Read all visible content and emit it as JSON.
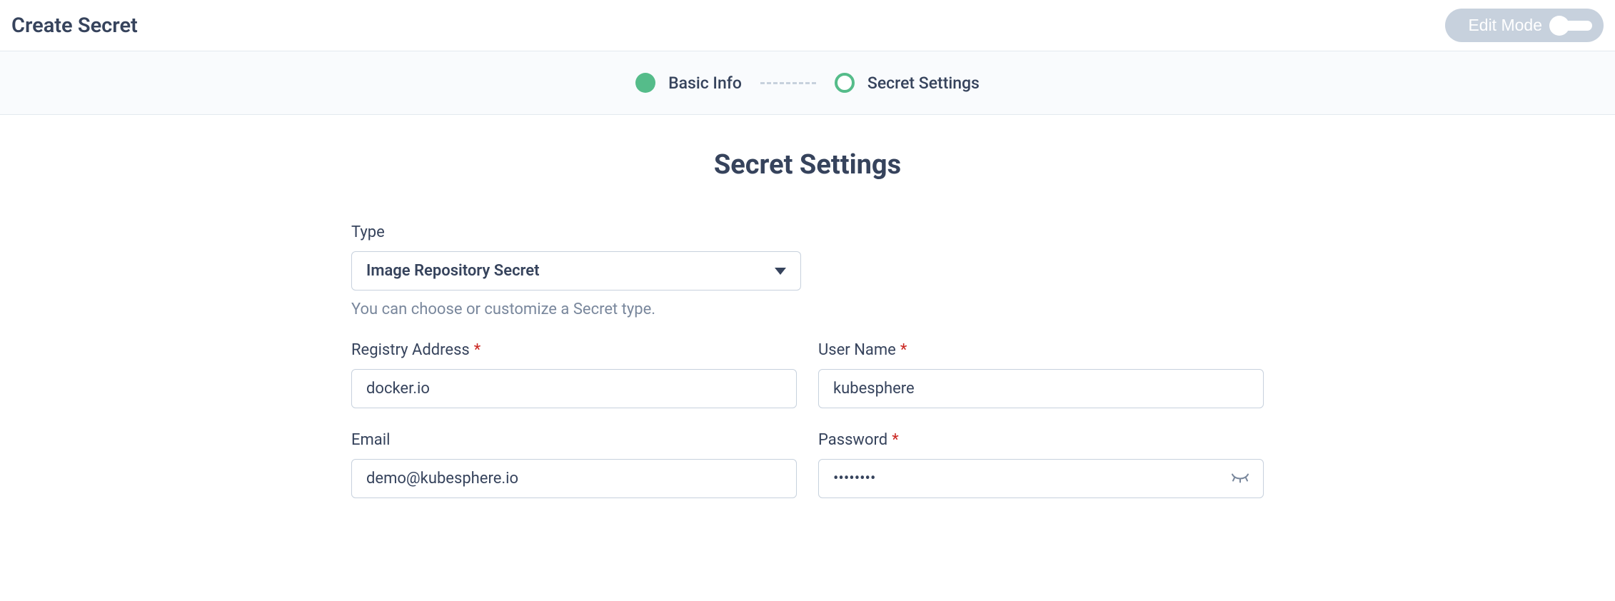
{
  "header": {
    "title": "Create Secret",
    "edit_mode_label": "Edit Mode"
  },
  "steps": {
    "step1": "Basic Info",
    "step2": "Secret Settings"
  },
  "main": {
    "title": "Secret Settings",
    "type_label": "Type",
    "type_value": "Image Repository Secret",
    "type_help": "You can choose or customize a Secret type.",
    "registry_label": "Registry Address",
    "registry_value": "docker.io",
    "username_label": "User Name",
    "username_value": "kubesphere",
    "email_label": "Email",
    "email_value": "demo@kubesphere.io",
    "password_label": "Password",
    "password_value": "••••••••"
  }
}
